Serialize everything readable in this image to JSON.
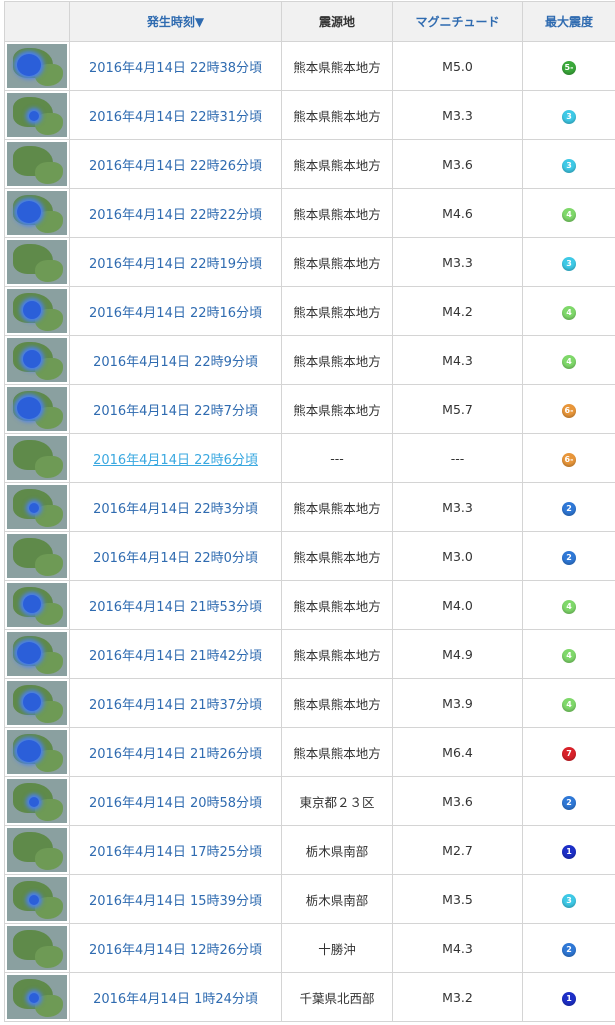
{
  "headers": {
    "thumb": "",
    "time": "発生時刻▼",
    "epicenter": "震源地",
    "magnitude": "マグニチュード",
    "intensity": "最大震度"
  },
  "intensity_colors": {
    "1": "#1d2fc7",
    "2": "#2f78d6",
    "3": "#3ec9e6",
    "4": "#7fd86a",
    "5-": "#3aa83a",
    "6-": "#e8963a",
    "7": "#d8222a"
  },
  "rows": [
    {
      "time": "2016年4月14日 22時38分頃",
      "epicenter": "熊本県熊本地方",
      "magnitude": "M5.0",
      "intensity": "5-",
      "map": "lg"
    },
    {
      "time": "2016年4月14日 22時31分頃",
      "epicenter": "熊本県熊本地方",
      "magnitude": "M3.3",
      "intensity": "3",
      "map": "sm"
    },
    {
      "time": "2016年4月14日 22時26分頃",
      "epicenter": "熊本県熊本地方",
      "magnitude": "M3.6",
      "intensity": "3",
      "map": "none"
    },
    {
      "time": "2016年4月14日 22時22分頃",
      "epicenter": "熊本県熊本地方",
      "magnitude": "M4.6",
      "intensity": "4",
      "map": "lg"
    },
    {
      "time": "2016年4月14日 22時19分頃",
      "epicenter": "熊本県熊本地方",
      "magnitude": "M3.3",
      "intensity": "3",
      "map": "none"
    },
    {
      "time": "2016年4月14日 22時16分頃",
      "epicenter": "熊本県熊本地方",
      "magnitude": "M4.2",
      "intensity": "4",
      "map": "md"
    },
    {
      "time": "2016年4月14日 22時9分頃",
      "epicenter": "熊本県熊本地方",
      "magnitude": "M4.3",
      "intensity": "4",
      "map": "md"
    },
    {
      "time": "2016年4月14日 22時7分頃",
      "epicenter": "熊本県熊本地方",
      "magnitude": "M5.7",
      "intensity": "6-",
      "map": "lg"
    },
    {
      "time": "2016年4月14日 22時6分頃",
      "epicenter": "---",
      "magnitude": "---",
      "intensity": "6-",
      "map": "none",
      "visited": true
    },
    {
      "time": "2016年4月14日 22時3分頃",
      "epicenter": "熊本県熊本地方",
      "magnitude": "M3.3",
      "intensity": "2",
      "map": "sm"
    },
    {
      "time": "2016年4月14日 22時0分頃",
      "epicenter": "熊本県熊本地方",
      "magnitude": "M3.0",
      "intensity": "2",
      "map": "none"
    },
    {
      "time": "2016年4月14日 21時53分頃",
      "epicenter": "熊本県熊本地方",
      "magnitude": "M4.0",
      "intensity": "4",
      "map": "md"
    },
    {
      "time": "2016年4月14日 21時42分頃",
      "epicenter": "熊本県熊本地方",
      "magnitude": "M4.9",
      "intensity": "4",
      "map": "lg"
    },
    {
      "time": "2016年4月14日 21時37分頃",
      "epicenter": "熊本県熊本地方",
      "magnitude": "M3.9",
      "intensity": "4",
      "map": "md"
    },
    {
      "time": "2016年4月14日 21時26分頃",
      "epicenter": "熊本県熊本地方",
      "magnitude": "M6.4",
      "intensity": "7",
      "map": "lg"
    },
    {
      "time": "2016年4月14日 20時58分頃",
      "epicenter": "東京都２３区",
      "magnitude": "M3.6",
      "intensity": "2",
      "map": "sm"
    },
    {
      "time": "2016年4月14日 17時25分頃",
      "epicenter": "栃木県南部",
      "magnitude": "M2.7",
      "intensity": "1",
      "map": "none"
    },
    {
      "time": "2016年4月14日 15時39分頃",
      "epicenter": "栃木県南部",
      "magnitude": "M3.5",
      "intensity": "3",
      "map": "sm"
    },
    {
      "time": "2016年4月14日 12時26分頃",
      "epicenter": "十勝沖",
      "magnitude": "M4.3",
      "intensity": "2",
      "map": "none"
    },
    {
      "time": "2016年4月14日 1時24分頃",
      "epicenter": "千葉県北西部",
      "magnitude": "M3.2",
      "intensity": "1",
      "map": "sm"
    }
  ]
}
